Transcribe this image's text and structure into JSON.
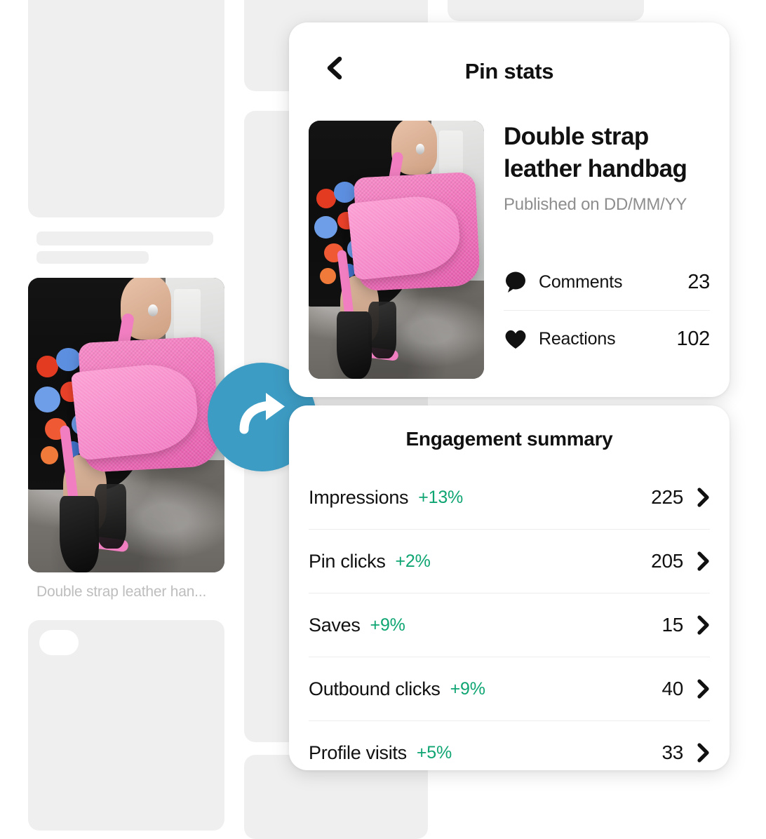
{
  "colors": {
    "accent_badge": "#3d9cc4",
    "positive_green": "#0fa573",
    "text_primary": "#111111",
    "text_muted": "#8e8e8e",
    "skeleton": "#efefef",
    "divider": "#ededed",
    "card_bg": "#ffffff"
  },
  "background_feed": {
    "pin_caption": "Double strap leather han...",
    "pin_image_alt": "Woman holding pink snakeskin leather handbag wearing black floral dress and black ankle boots"
  },
  "share_badge": {
    "icon": "share-arrow-icon",
    "color": "#3d9cc4"
  },
  "modal": {
    "header": {
      "back_icon": "chevron-left-icon",
      "title": "Pin stats"
    },
    "pin": {
      "image_alt": "Woman holding pink snakeskin leather handbag wearing black floral dress and black ankle boots",
      "title": "Double strap leather handbag",
      "published": "Published on DD/MM/YY",
      "stats": [
        {
          "icon": "comment-bubble-icon",
          "label": "Comments",
          "value": "23"
        },
        {
          "icon": "heart-icon",
          "label": "Reactions",
          "value": "102"
        }
      ]
    },
    "engagement": {
      "title": "Engagement summary",
      "rows": [
        {
          "label": "Impressions",
          "delta": "+13%",
          "value": "225",
          "chevron": "chevron-right-icon"
        },
        {
          "label": "Pin clicks",
          "delta": "+2%",
          "value": "205",
          "chevron": "chevron-right-icon"
        },
        {
          "label": "Saves",
          "delta": "+9%",
          "value": "15",
          "chevron": "chevron-right-icon"
        },
        {
          "label": "Outbound clicks",
          "delta": "+9%",
          "value": "40",
          "chevron": "chevron-right-icon"
        },
        {
          "label": "Profile visits",
          "delta": "+5%",
          "value": "33",
          "chevron": "chevron-right-icon"
        }
      ]
    }
  }
}
